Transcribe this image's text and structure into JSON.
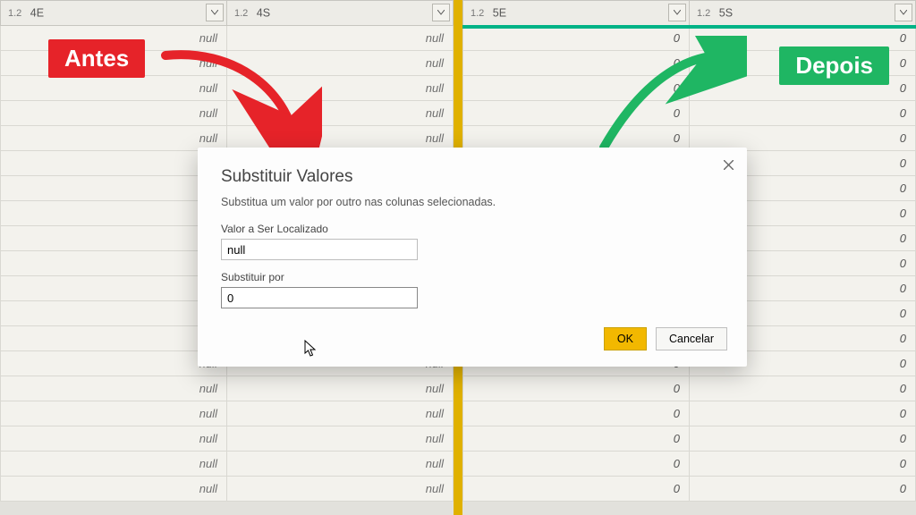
{
  "before": {
    "label": "Antes",
    "columns": [
      {
        "type": "1.2",
        "name": "4E"
      },
      {
        "type": "1.2",
        "name": "4S"
      }
    ],
    "cell": "null",
    "rowCount": 19
  },
  "after": {
    "label": "Depois",
    "columns": [
      {
        "type": "1.2",
        "name": "5E"
      },
      {
        "type": "1.2",
        "name": "5S"
      }
    ],
    "cell": "0",
    "rowCount": 19
  },
  "dialog": {
    "title": "Substituir Valores",
    "subtitle": "Substitua um valor por outro nas colunas selecionadas.",
    "findLabel": "Valor a Ser Localizado",
    "findValue": "null",
    "replaceLabel": "Substituir por",
    "replaceValue": "0",
    "ok": "OK",
    "cancel": "Cancelar"
  }
}
